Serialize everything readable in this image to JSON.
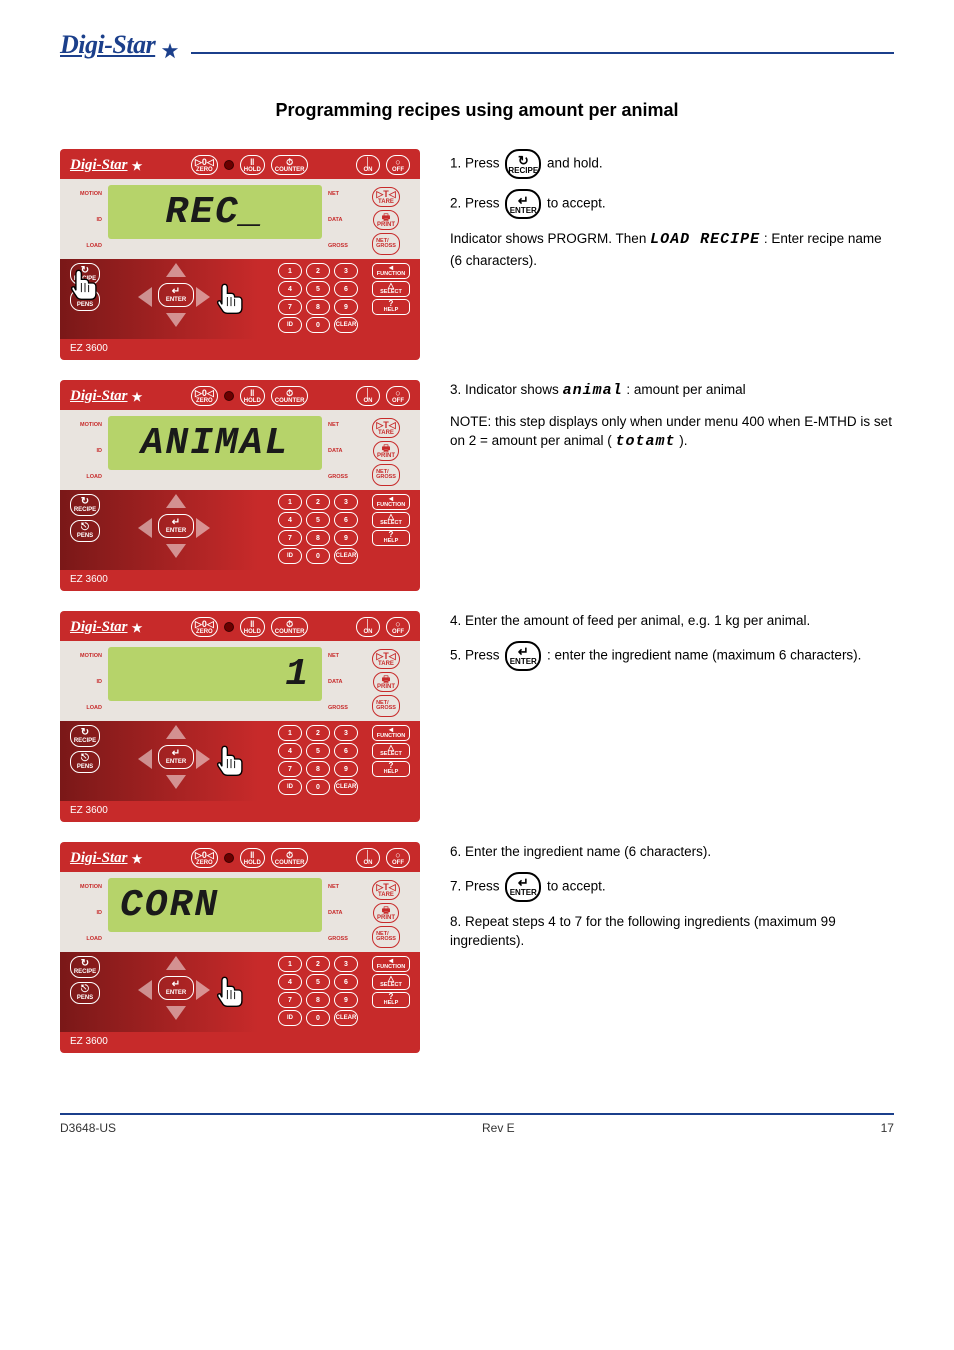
{
  "header": {
    "brand": "Digi-Star"
  },
  "section_title": "Programming recipes using amount per animal",
  "steps": {
    "s1": {
      "display": "REC_",
      "text1_a": "1. Press ",
      "text1_b": " and hold.",
      "text2_a": "2. Press ",
      "text2_b": " to accept.",
      "text3_a": "Indicator shows PROGRM. Then ",
      "word1": "LOAD RECIPE",
      "text3_b": ": Enter recipe name (6 characters)."
    },
    "s2": {
      "display": "ANIMAL",
      "text1_a": "3. Indicator shows ",
      "word1": "animal",
      "text1_b": ": amount per animal",
      "note": "NOTE: this step displays only when under menu 400 when E-MTHD is set on 2 = amount per animal (",
      "word2": "totamt",
      "note_tail": ")."
    },
    "s3": {
      "display": "1",
      "text1": "4. Enter the amount of feed per animal, e.g. 1 kg per animal.",
      "text2_a": "5. Press ",
      "text2_b": ": enter the ingredient name (maximum 6 characters)."
    },
    "s4": {
      "display": "CORN",
      "text1": "6. Enter the ingredient name (6 characters).",
      "text2_a": "7. Press ",
      "text2_b": " to accept.",
      "text3": "8. Repeat steps 4 to 7 for the following ingredients (maximum 99 ingredients)."
    }
  },
  "panel": {
    "brand": "Digi-Star",
    "model": "EZ 3600",
    "top_buttons": {
      "zero": "ZERO",
      "hold": "HOLD",
      "timer": "COUNTER",
      "on": "ON",
      "off": "OFF"
    },
    "side_buttons": {
      "tare": "TARE",
      "print": "PRINT",
      "netgross": "NET/\nGROSS"
    },
    "left_labels": {
      "motion": "MOTION",
      "id": "ID",
      "load": "LOAD"
    },
    "right_labels": {
      "net": "NET",
      "data": "DATA",
      "gross": "GROSS"
    },
    "left_col": {
      "recipe": "RECIPE",
      "pens": "PENS"
    },
    "enter": "ENTER",
    "keys": [
      "1",
      "2",
      "3",
      "4",
      "5",
      "6",
      "7",
      "8",
      "9",
      "ID",
      "0",
      "CLEAR"
    ],
    "right_fn": {
      "function": "FUNCTION",
      "select": "SELECT",
      "help": "HELP"
    },
    "right_fn_sym": {
      "function": "◂",
      "select": "△",
      "help": "?"
    }
  },
  "inline_icons": {
    "recipe": "RECIPE",
    "enter": "ENTER"
  },
  "footer": {
    "code": "D3648-US",
    "rev": "Rev E",
    "page": "17"
  }
}
